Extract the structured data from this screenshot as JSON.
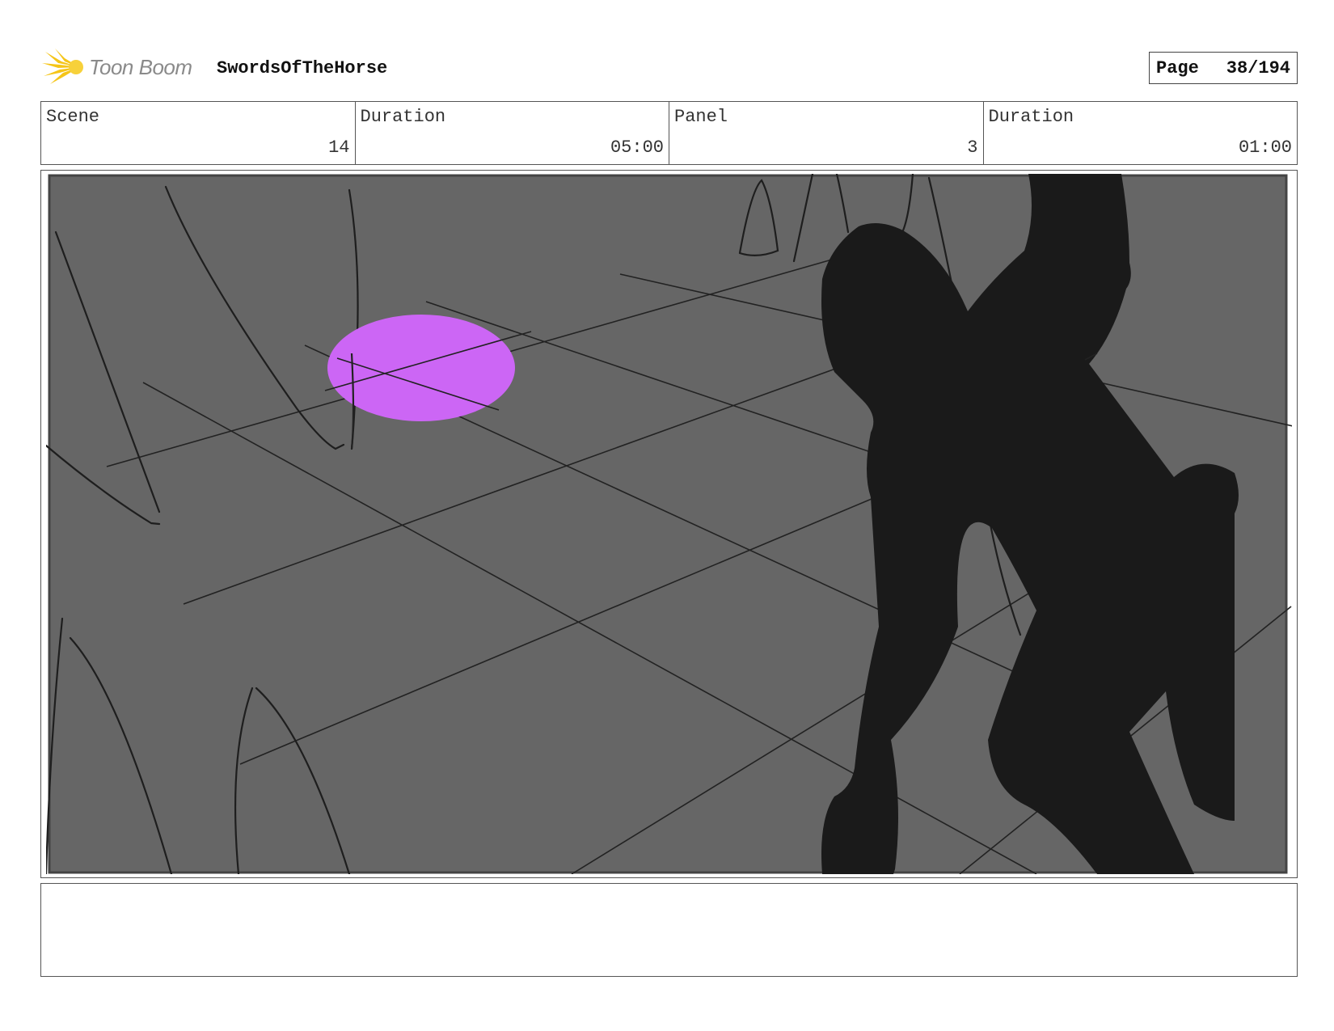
{
  "brand": {
    "name": "Toon Boom",
    "accent": "#f5c518",
    "logo_icon": "starburst-icon"
  },
  "project": {
    "title": "SwordsOfTheHorse"
  },
  "page": {
    "label": "Page",
    "value": "38/194"
  },
  "info": {
    "scene_label": "Scene",
    "scene_value": "14",
    "scene_duration_label": "Duration",
    "scene_duration_value": "05:00",
    "panel_label": "Panel",
    "panel_value": "3",
    "panel_duration_label": "Duration",
    "panel_duration_value": "01:00"
  },
  "panel_image": {
    "description_colors": {
      "background": "#666666",
      "silhouette": "#1a1a1a",
      "spot": "#cc66f5"
    }
  },
  "caption": {
    "text": ""
  }
}
